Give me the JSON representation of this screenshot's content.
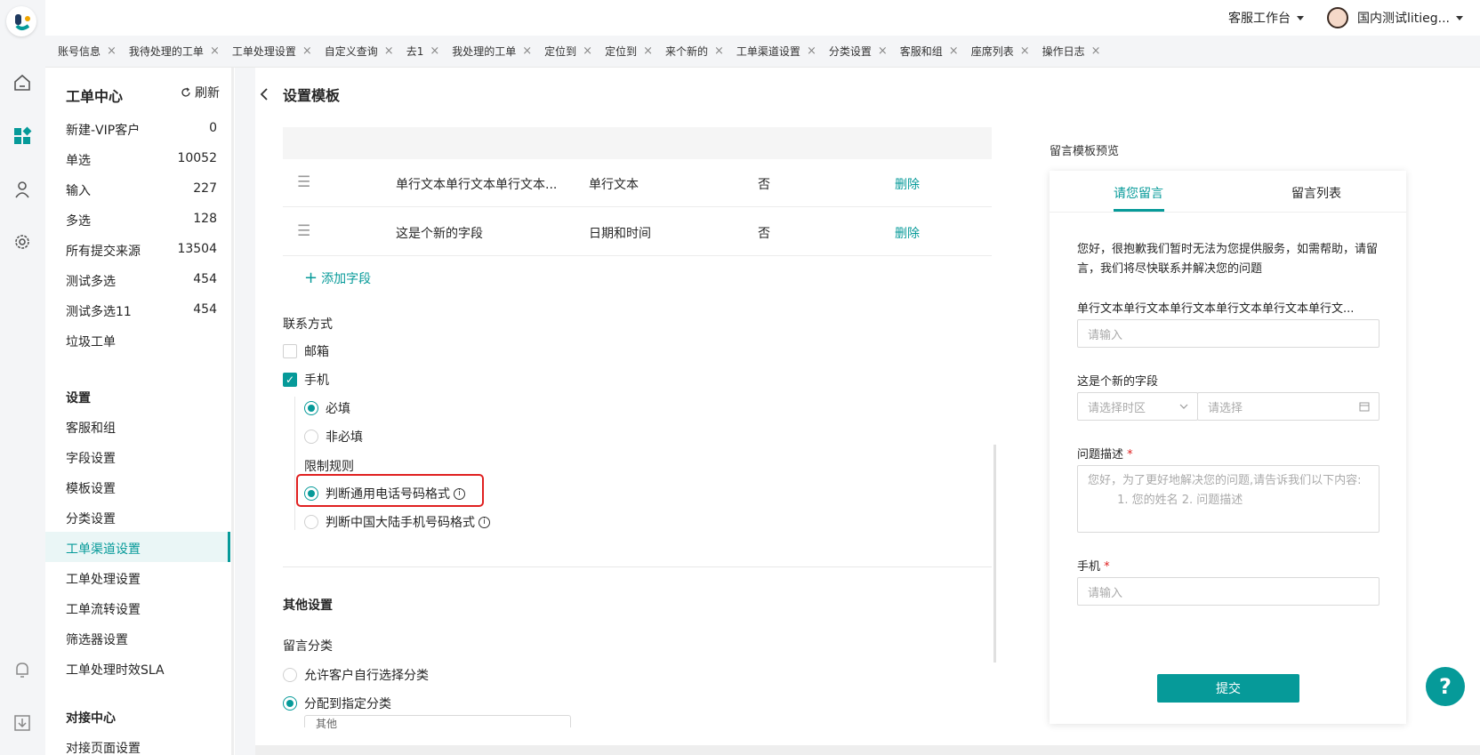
{
  "header": {
    "workspace_label": "客服工作台",
    "user_name": "国内测试litieg..."
  },
  "tabs": [
    {
      "label": "账号信息"
    },
    {
      "label": "我待处理的工单"
    },
    {
      "label": "工单处理设置"
    },
    {
      "label": "自定义查询"
    },
    {
      "label": "去1"
    },
    {
      "label": "我处理的工单"
    },
    {
      "label": "定位到"
    },
    {
      "label": "定位到"
    },
    {
      "label": "来个新的"
    },
    {
      "label": "工单渠道设置"
    },
    {
      "label": "分类设置"
    },
    {
      "label": "客服和组"
    },
    {
      "label": "座席列表"
    },
    {
      "label": "操作日志"
    }
  ],
  "close_glyph": "×",
  "sidebar": {
    "title": "工单中心",
    "refresh_label": "刷新",
    "ticket_items": [
      {
        "label": "新建-VIP客户",
        "count": "0"
      },
      {
        "label": "单选",
        "count": "10052"
      },
      {
        "label": "输入",
        "count": "227"
      },
      {
        "label": "多选",
        "count": "128"
      },
      {
        "label": "所有提交来源",
        "count": "13504"
      },
      {
        "label": "测试多选",
        "count": "454"
      },
      {
        "label": "测试多选11",
        "count": "454"
      },
      {
        "label": "垃圾工单",
        "count": ""
      }
    ],
    "settings_heading": "设置",
    "settings_items": [
      {
        "label": "客服和组"
      },
      {
        "label": "字段设置"
      },
      {
        "label": "模板设置"
      },
      {
        "label": "分类设置"
      },
      {
        "label": "工单渠道设置",
        "active": true
      },
      {
        "label": "工单处理设置"
      },
      {
        "label": "工单流转设置"
      },
      {
        "label": "筛选器设置"
      },
      {
        "label": "工单处理时效SLA"
      }
    ],
    "integration_heading": "对接中心",
    "integration_items": [
      {
        "label": "对接页面设置"
      }
    ]
  },
  "main": {
    "title": "设置模板",
    "fields": [
      {
        "name": "单行文本单行文本单行文本...",
        "type": "单行文本",
        "required": "否",
        "action": "删除"
      },
      {
        "name": "这是个新的字段",
        "type": "日期和时间",
        "required": "否",
        "action": "删除"
      }
    ],
    "add_field": "添加字段",
    "contact_label": "联系方式",
    "email_label": "邮箱",
    "phone_label": "手机",
    "required_label": "必填",
    "optional_label": "非必填",
    "rule_label": "限制规则",
    "rule_general": "判断通用电话号码格式",
    "rule_china": "判断中国大陆手机号码格式",
    "other_settings": "其他设置",
    "msg_category_label": "留言分类",
    "allow_customer_choose": "允许客户自行选择分类",
    "assign_category": "分配到指定分类",
    "category_value": "其他"
  },
  "preview": {
    "title": "留言模板预览",
    "tab_leave_msg": "请您留言",
    "tab_msg_list": "留言列表",
    "intro": "您好，很抱歉我们暂时无法为您提供服务，如需帮助，请留言，我们将尽快联系并解决您的问题",
    "field1_label": "单行文本单行文本单行文本单行文本单行文本单行文...",
    "field1_placeholder": "请输入",
    "field2_label": "这是个新的字段",
    "timezone_placeholder": "请选择时区",
    "date_placeholder": "请选择",
    "desc_label": "问题描述",
    "desc_placeholder": "您好，为了更好地解决您的问题,请告诉我们以下内容:\n        1. 您的姓名 2. 问题描述",
    "phone_label": "手机",
    "phone_placeholder": "请输入",
    "submit_label": "提交",
    "required_mark": "*"
  },
  "colors": {
    "accent": "#069a99",
    "highlight": "#e02020"
  }
}
